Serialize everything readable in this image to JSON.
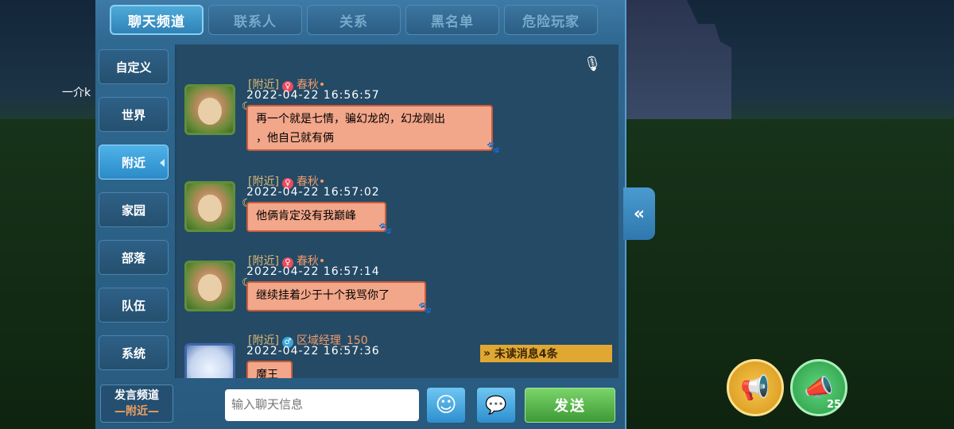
{
  "tabs": [
    {
      "label": "聊天频道",
      "active": true
    },
    {
      "label": "联系人",
      "active": false
    },
    {
      "label": "关系",
      "active": false
    },
    {
      "label": "黑名单",
      "active": false
    },
    {
      "label": "危险玩家",
      "active": false
    }
  ],
  "sidebar": [
    {
      "label": "自定义"
    },
    {
      "label": "世界"
    },
    {
      "label": "附近",
      "active": true
    },
    {
      "label": "家园"
    },
    {
      "label": "部落"
    },
    {
      "label": "队伍"
    },
    {
      "label": "系统"
    }
  ],
  "background": {
    "left_text": "一介k"
  },
  "messages": [
    {
      "channel": "[附近]",
      "name": "春秋•",
      "gender": "female",
      "time": "2022-04-22   16:56:57",
      "text_lines": [
        "再一个就是七情，骗幻龙的，幻龙刚出",
        "，他自己就有俩"
      ]
    },
    {
      "channel": "[附近]",
      "name": "春秋•",
      "gender": "female",
      "time": "2022-04-22   16:57:02",
      "text_lines": [
        "他俩肯定没有我巅峰"
      ]
    },
    {
      "channel": "[附近]",
      "name": "春秋•",
      "gender": "female",
      "time": "2022-04-22   16:57:14",
      "text_lines": [
        "继续挂着少于十个我骂你了"
      ]
    },
    {
      "channel": "[附近]",
      "name": "区域经理_150",
      "gender": "male",
      "time": "2022-04-22   16:57:36",
      "text_lines": [
        "魔王"
      ]
    }
  ],
  "unread": {
    "label": "未读消息4条"
  },
  "bottom": {
    "speak_title": "发言频道",
    "speak_channel": "—附近—",
    "input_placeholder": "输入聊天信息",
    "send_label": "发送",
    "horn_count": "25"
  },
  "colors": {
    "panel": "#2f6890",
    "bubble": "#f2a68a",
    "send": "#4caa3f",
    "unread": "#e0a832"
  }
}
